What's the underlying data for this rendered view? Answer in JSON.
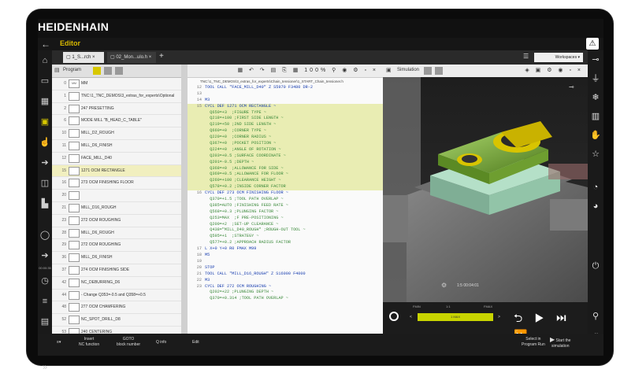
{
  "brand": "HEIDENHAIN",
  "titlebar": {
    "back": "←",
    "title": "Editor",
    "warning": "⚠"
  },
  "tabs": [
    {
      "label": "1_S...rch"
    },
    {
      "label": "02_Mon...ulo.h"
    }
  ],
  "tabbar": {
    "plus": "+",
    "workspaces": "Workspaces"
  },
  "left_times": [
    "00:00:35",
    "10:35"
  ],
  "program": {
    "label": "Program",
    "rows": [
      {
        "num": "0",
        "icon": "MM",
        "text": "MM"
      },
      {
        "num": "1",
        "icon": "",
        "text": "TNC:\\1_TNC_DEMOS\\3_extras_for_experts\\Optional"
      },
      {
        "num": "2",
        "icon": "",
        "text": "247 PRESETTING"
      },
      {
        "num": "6",
        "icon": "",
        "text": "MODE MILL \"B_HEAD_C_TABLE\""
      },
      {
        "num": "10",
        "icon": "",
        "text": "MILL_D2_ROUGH"
      },
      {
        "num": "11",
        "icon": "",
        "text": "MILL_D6_FINISH"
      },
      {
        "num": "12",
        "icon": "",
        "text": "FACE_MILL_D40"
      },
      {
        "num": "15",
        "icon": "",
        "text": "1271 OCM RECTANGLE"
      },
      {
        "num": "16",
        "icon": "",
        "text": "273 OCM FINISHING FLOOR"
      },
      {
        "num": "20",
        "icon": "",
        "text": ""
      },
      {
        "num": "21",
        "icon": "",
        "text": "MILL_D16_ROUGH"
      },
      {
        "num": "23",
        "icon": "",
        "text": "272 OCM ROUGHING"
      },
      {
        "num": "28",
        "icon": "",
        "text": "MILL_D6_ROUGH"
      },
      {
        "num": "29",
        "icon": "",
        "text": "272 OCM ROUGHING"
      },
      {
        "num": "36",
        "icon": "",
        "text": "MILL_D6_FINISH"
      },
      {
        "num": "37",
        "icon": "",
        "text": "274 OCM FINISHING SIDE"
      },
      {
        "num": "42",
        "icon": "",
        "text": "NC_DEBURRING_D6"
      },
      {
        "num": "44",
        "icon": "",
        "text": "- Change Q353=-0.5 and Q358=+0.5"
      },
      {
        "num": "48",
        "icon": "",
        "text": "277 OCM CHAMFERING"
      },
      {
        "num": "52",
        "icon": "",
        "text": "NC_SPOT_DRILL_D8"
      },
      {
        "num": "53",
        "icon": "",
        "text": "240 CENTERING"
      }
    ]
  },
  "editor": {
    "path": "TNC:\\1_TNC_DEMOS\\3_extras_for_experts\\Chain_tensioner\\1_START_Chain_tensioner.h",
    "zoom": "100%",
    "lines": [
      {
        "n": "12",
        "t": "TOOL CALL \"FACE_MILL_D40\" Z S5970 F3480 DR-2"
      },
      {
        "n": "13",
        "t": ""
      },
      {
        "n": "14",
        "t": "M3"
      },
      {
        "n": "15",
        "t": "CYCL DEF 1271 OCM RECTANGLE ~"
      },
      {
        "n": "",
        "t": "  Q650=+3  ;FIGURE TYPE ~"
      },
      {
        "n": "",
        "t": "  Q218=+100 ;FIRST SIDE LENGTH ~"
      },
      {
        "n": "",
        "t": "  Q219=+50 ;2ND SIDE LENGTH ~"
      },
      {
        "n": "",
        "t": "  Q660=+0  ;CORNER TYPE ~"
      },
      {
        "n": "",
        "t": "  Q220=+0  ;CORNER RADIUS ~"
      },
      {
        "n": "",
        "t": "  Q367=+0  ;POCKET POSITION ~"
      },
      {
        "n": "",
        "t": "  Q224=+0  ;ANGLE OF ROTATION ~"
      },
      {
        "n": "",
        "t": "  Q203=+0.5 ;SURFACE COORDINATE ~"
      },
      {
        "n": "",
        "t": "  Q201=-0.5 ;DEPTH ~"
      },
      {
        "n": "",
        "t": "  Q368=+0  ;ALLOWANCE FOR SIDE ~"
      },
      {
        "n": "",
        "t": "  Q369=+0.5 ;ALLOWANCE FOR FLOOR ~"
      },
      {
        "n": "",
        "t": "  Q260=+100 ;CLEARANCE HEIGHT ~"
      },
      {
        "n": "",
        "t": "  Q578=+0.2 ;INSIDE CORNER FACTOR"
      },
      {
        "n": "16",
        "t": "CYCL DEF 273 OCM FINISHING FLOOR ~"
      },
      {
        "n": "",
        "t": "  Q370=+1.5 ;TOOL PATH OVERLAP ~"
      },
      {
        "n": "",
        "t": "  Q385=AUTO ;FINISHING FEED RATE ~"
      },
      {
        "n": "",
        "t": "  Q568=+0.3 ;PLUNGING FACTOR ~"
      },
      {
        "n": "",
        "t": "  Q253=MAX  ;F PRE-POSITIONING ~"
      },
      {
        "n": "",
        "t": "  Q200=+2  ;SET-UP CLEARANCE ~"
      },
      {
        "n": "",
        "t": "  Q438=\"MILL_D40_ROUGH\" ;ROUGH-OUT TOOL ~"
      },
      {
        "n": "",
        "t": "  Q595=+1  ;STRATEGY ~"
      },
      {
        "n": "",
        "t": "  Q577=+0.2 ;APPROACH RADIUS FACTOR"
      },
      {
        "n": "17",
        "t": "L X+0 Y+0 R0 FMAX M99"
      },
      {
        "n": "18",
        "t": "M5"
      },
      {
        "n": "19",
        "t": ""
      },
      {
        "n": "20",
        "t": "STOP"
      },
      {
        "n": "21",
        "t": "TOOL CALL \"MILL_D16_ROUGH\" Z S16000 F4000"
      },
      {
        "n": "22",
        "t": "M3"
      },
      {
        "n": "23",
        "t": "CYCL DEF 272 OCM ROUGHING ~"
      },
      {
        "n": "",
        "t": "  Q202=+22 ;PLUNGING DEPTH ~"
      },
      {
        "n": "",
        "t": "  Q370=+0.314 ;TOOL PATH OVERLAP ~"
      }
    ]
  },
  "simulation": {
    "label": "Simulation",
    "time": "1:5 00:04:01",
    "fmin": "FMIN",
    "fmax": "FMAX",
    "center": "1:1",
    "speed": "1 MAX",
    "lt": "<",
    "gt": ">"
  },
  "bottom": [
    {
      "label": "Insert\nNC function"
    },
    {
      "label": "GOTO\nblock number"
    },
    {
      "label": "Q info"
    },
    {
      "label": "Edit"
    },
    {
      "label": "Select in\nProgram Run"
    },
    {
      "label": "Start the\nsimulation"
    }
  ],
  "colors": {
    "accent": "#d8c800",
    "highlight": "#e9edb3",
    "model_green": "#7fa83a"
  }
}
